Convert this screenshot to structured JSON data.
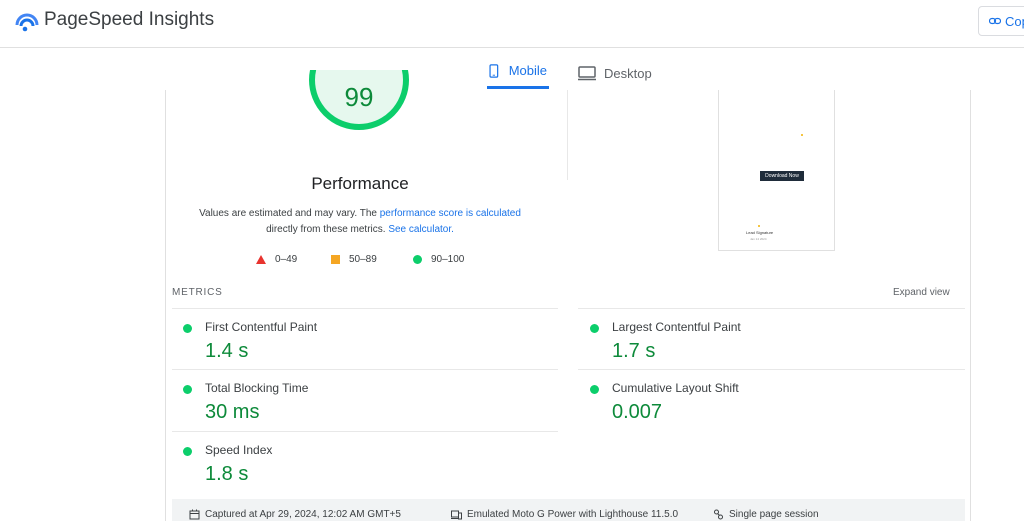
{
  "header": {
    "app_title": "PageSpeed Insights",
    "copy_label": "Cop"
  },
  "tabs": [
    {
      "label": "Mobile",
      "active": true
    },
    {
      "label": "Desktop",
      "active": false
    }
  ],
  "performance": {
    "score": "99",
    "title": "Performance",
    "note_prefix": "Values are estimated and may vary. The ",
    "note_link1": "performance score is calculated",
    "note_middle": "directly from these metrics. ",
    "note_link2": "See calculator."
  },
  "legend": [
    {
      "range": "0–49",
      "color": "#e8332e"
    },
    {
      "range": "50–89",
      "color": "#f5a623"
    },
    {
      "range": "90–100",
      "color": "#0cce6b"
    }
  ],
  "screenshot": {
    "button_text": "Download Now",
    "line1": "Lead Signature",
    "line2": "Jan 14 2024"
  },
  "metrics": {
    "label": "METRICS",
    "expand": "Expand view",
    "items": [
      {
        "name": "First Contentful Paint",
        "value": "1.4 s"
      },
      {
        "name": "Largest Contentful Paint",
        "value": "1.7 s"
      },
      {
        "name": "Total Blocking Time",
        "value": "30 ms"
      },
      {
        "name": "Cumulative Layout Shift",
        "value": "0.007"
      },
      {
        "name": "Speed Index",
        "value": "1.8 s"
      }
    ]
  },
  "footer": {
    "captured": "Captured at Apr 29, 2024, 12:02 AM GMT+5",
    "device": "Emulated Moto G Power with Lighthouse 11.5.0",
    "session": "Single page session"
  },
  "colors": {
    "accent": "#1a73e8",
    "good": "#0cce6b",
    "good_text": "#0d8a3a"
  }
}
